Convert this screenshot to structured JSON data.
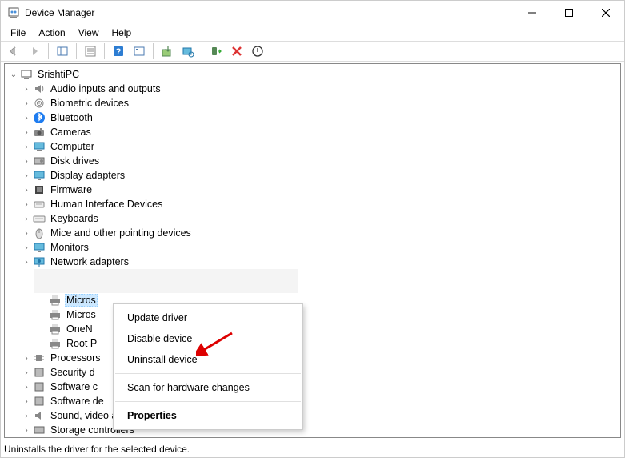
{
  "window": {
    "title": "Device Manager"
  },
  "menu": {
    "file": "File",
    "action": "Action",
    "view": "View",
    "help": "Help"
  },
  "tree": {
    "root": "SrishtiPC",
    "cats": [
      "Audio inputs and outputs",
      "Biometric devices",
      "Bluetooth",
      "Cameras",
      "Computer",
      "Disk drives",
      "Display adapters",
      "Firmware",
      "Human Interface Devices",
      "Keyboards",
      "Mice and other pointing devices",
      "Monitors",
      "Network adapters"
    ],
    "sub": {
      "s0": "Micros",
      "s1": "Micros",
      "s2": "OneN",
      "s3": "Root P"
    },
    "cats2": [
      "Processors",
      "Security d",
      "Software c",
      "Software de",
      "Sound, video and game controllers",
      "Storage controllers"
    ]
  },
  "ctx": {
    "update": "Update driver",
    "disable": "Disable device",
    "uninstall": "Uninstall device",
    "scan": "Scan for hardware changes",
    "props": "Properties"
  },
  "status": "Uninstalls the driver for the selected device."
}
